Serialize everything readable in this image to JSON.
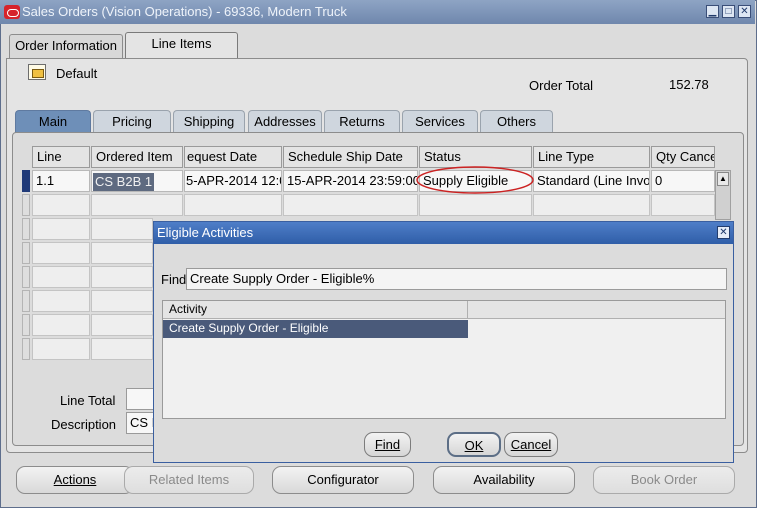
{
  "window": {
    "title": "Sales Orders (Vision Operations) - 69336, Modern Truck",
    "controls": [
      "minimize",
      "maximize",
      "close"
    ]
  },
  "top_tabs": [
    {
      "label": "Order Information",
      "active": false
    },
    {
      "label": "Line Items",
      "active": true
    }
  ],
  "default_label": "Default",
  "order_total": {
    "label": "Order Total",
    "value": "152.78"
  },
  "sub_tabs": [
    {
      "label": "Main",
      "active": true
    },
    {
      "label": "Pricing"
    },
    {
      "label": "Shipping"
    },
    {
      "label": "Addresses"
    },
    {
      "label": "Returns"
    },
    {
      "label": "Services"
    },
    {
      "label": "Others"
    }
  ],
  "lines_table": {
    "columns": [
      "Line",
      "Ordered Item",
      "equest Date",
      "Schedule Ship Date",
      "Status",
      "Line Type",
      "Qty Cance"
    ],
    "rows": [
      [
        "1.1",
        "CS B2B 1",
        "5-APR-2014 12:0",
        "15-APR-2014 23:59:00",
        "Supply Eligible",
        "Standard (Line Invo",
        "0"
      ]
    ]
  },
  "line_total_label": "Line Total",
  "description": {
    "label": "Description",
    "value": "CS I"
  },
  "bottom_buttons": [
    {
      "label": "Actions",
      "enabled": true
    },
    {
      "label": "Related Items",
      "enabled": false
    },
    {
      "label": "Configurator",
      "enabled": true
    },
    {
      "label": "Availability",
      "enabled": true
    },
    {
      "label": "Book Order",
      "enabled": false
    }
  ],
  "dialog": {
    "title": "Eligible Activities",
    "find_label": "Find",
    "find_value": "Create Supply Order - Eligible%",
    "column": "Activity",
    "items": [
      "Create Supply Order - Eligible"
    ],
    "buttons": {
      "find": "Find",
      "ok": "OK",
      "cancel": "Cancel"
    }
  },
  "colors": {
    "active_tab": "#6e8fb8",
    "dialog_title": "#2f5ea8",
    "selected_row": "#4a5a7a",
    "status_highlight": "#cc2222"
  }
}
